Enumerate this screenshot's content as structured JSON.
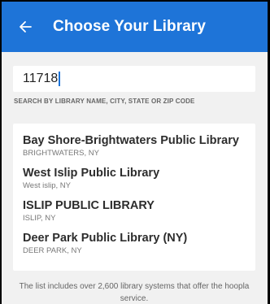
{
  "header": {
    "title": "Choose Your Library",
    "back_icon": "arrow-left-icon"
  },
  "search": {
    "value": "11718",
    "hint": "SEARCH BY LIBRARY NAME, CITY, STATE OR ZIP CODE"
  },
  "results": [
    {
      "name": "Bay Shore-Brightwaters Public Library",
      "location": "BRIGHTWATERS, NY"
    },
    {
      "name": "West Islip Public Library",
      "location": "West islip, NY"
    },
    {
      "name": "ISLIP PUBLIC LIBRARY",
      "location": "ISLIP, NY"
    },
    {
      "name": "Deer Park Public Library (NY)",
      "location": "DEER PARK, NY"
    }
  ],
  "footer": {
    "text": "The list includes over 2,600 library systems that offer the hoopla service."
  },
  "colors": {
    "accent": "#1e74d8",
    "background": "#f1f1f1"
  }
}
